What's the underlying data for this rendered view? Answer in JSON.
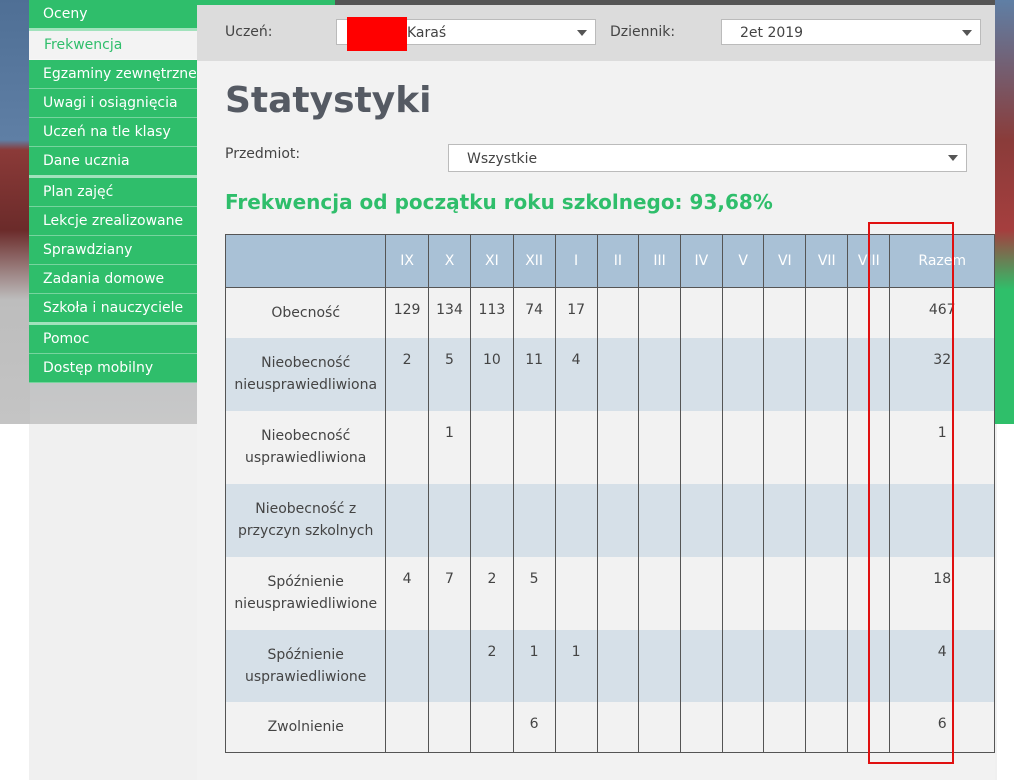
{
  "sidebar": {
    "items": [
      {
        "label": "Oceny",
        "active": false,
        "group_end": true
      },
      {
        "label": "Frekwencja",
        "active": true,
        "group_end": false
      },
      {
        "label": "Egzaminy zewnętrzne",
        "active": false,
        "group_end": false
      },
      {
        "label": "Uwagi i osiągnięcia",
        "active": false,
        "group_end": false
      },
      {
        "label": "Uczeń na tle klasy",
        "active": false,
        "group_end": false
      },
      {
        "label": "Dane ucznia",
        "active": false,
        "group_end": true
      },
      {
        "label": "Plan zajęć",
        "active": false,
        "group_end": false
      },
      {
        "label": "Lekcje zrealizowane",
        "active": false,
        "group_end": false
      },
      {
        "label": "Sprawdziany",
        "active": false,
        "group_end": false
      },
      {
        "label": "Zadania domowe",
        "active": false,
        "group_end": false
      },
      {
        "label": "Szkoła i nauczyciele",
        "active": false,
        "group_end": true
      },
      {
        "label": "Pomoc",
        "active": false,
        "group_end": false
      },
      {
        "label": "Dostęp mobilny",
        "active": false,
        "group_end": false
      }
    ]
  },
  "topbar": {
    "student_label": "Uczeń:",
    "student_value": "Karaś",
    "journal_label": "Dziennik:",
    "journal_value": "2et 2019"
  },
  "main": {
    "title": "Statystyki",
    "subject_label": "Przedmiot:",
    "subject_value": "Wszystkie",
    "summary": "Frekwencja od początku roku szkolnego: 93,68%"
  },
  "table": {
    "headers": [
      "",
      "IX",
      "X",
      "XI",
      "XII",
      "I",
      "II",
      "III",
      "IV",
      "V",
      "VI",
      "VII",
      "VIII",
      "Razem"
    ],
    "rows": [
      {
        "label": "Obecność",
        "values": [
          "129",
          "134",
          "113",
          "74",
          "17",
          "",
          "",
          "",
          "",
          "",
          "",
          "",
          "467"
        ]
      },
      {
        "label": "Nieobecność nieusprawiedliwiona",
        "values": [
          "2",
          "5",
          "10",
          "11",
          "4",
          "",
          "",
          "",
          "",
          "",
          "",
          "",
          "32"
        ]
      },
      {
        "label": "Nieobecność usprawiedliwiona",
        "values": [
          "",
          "1",
          "",
          "",
          "",
          "",
          "",
          "",
          "",
          "",
          "",
          "",
          "1"
        ]
      },
      {
        "label": "Nieobecność z przyczyn szkolnych",
        "values": [
          "",
          "",
          "",
          "",
          "",
          "",
          "",
          "",
          "",
          "",
          "",
          "",
          ""
        ]
      },
      {
        "label": "Spóźnienie nieusprawiedliwione",
        "values": [
          "4",
          "7",
          "2",
          "5",
          "",
          "",
          "",
          "",
          "",
          "",
          "",
          "",
          "18"
        ]
      },
      {
        "label": "Spóźnienie usprawiedliwione",
        "values": [
          "",
          "",
          "2",
          "1",
          "1",
          "",
          "",
          "",
          "",
          "",
          "",
          "",
          "4"
        ]
      },
      {
        "label": "Zwolnienie",
        "values": [
          "",
          "",
          "",
          "6",
          "",
          "",
          "",
          "",
          "",
          "",
          "",
          "",
          "6"
        ]
      }
    ]
  },
  "colors": {
    "accent_green": "#2fbe6b",
    "header_blue": "#a9c1d6",
    "row_alt": "#d6e0e8",
    "highlight_red": "#e01010"
  }
}
